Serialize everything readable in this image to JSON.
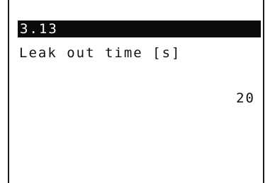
{
  "display": {
    "parameter_code": "3.13",
    "parameter_name": "Leak out time [s]",
    "parameter_value": "20"
  },
  "colors": {
    "header_background": "#0a0a0a",
    "header_text": "#ffffff",
    "text": "#111111",
    "background": "#ffffff"
  }
}
